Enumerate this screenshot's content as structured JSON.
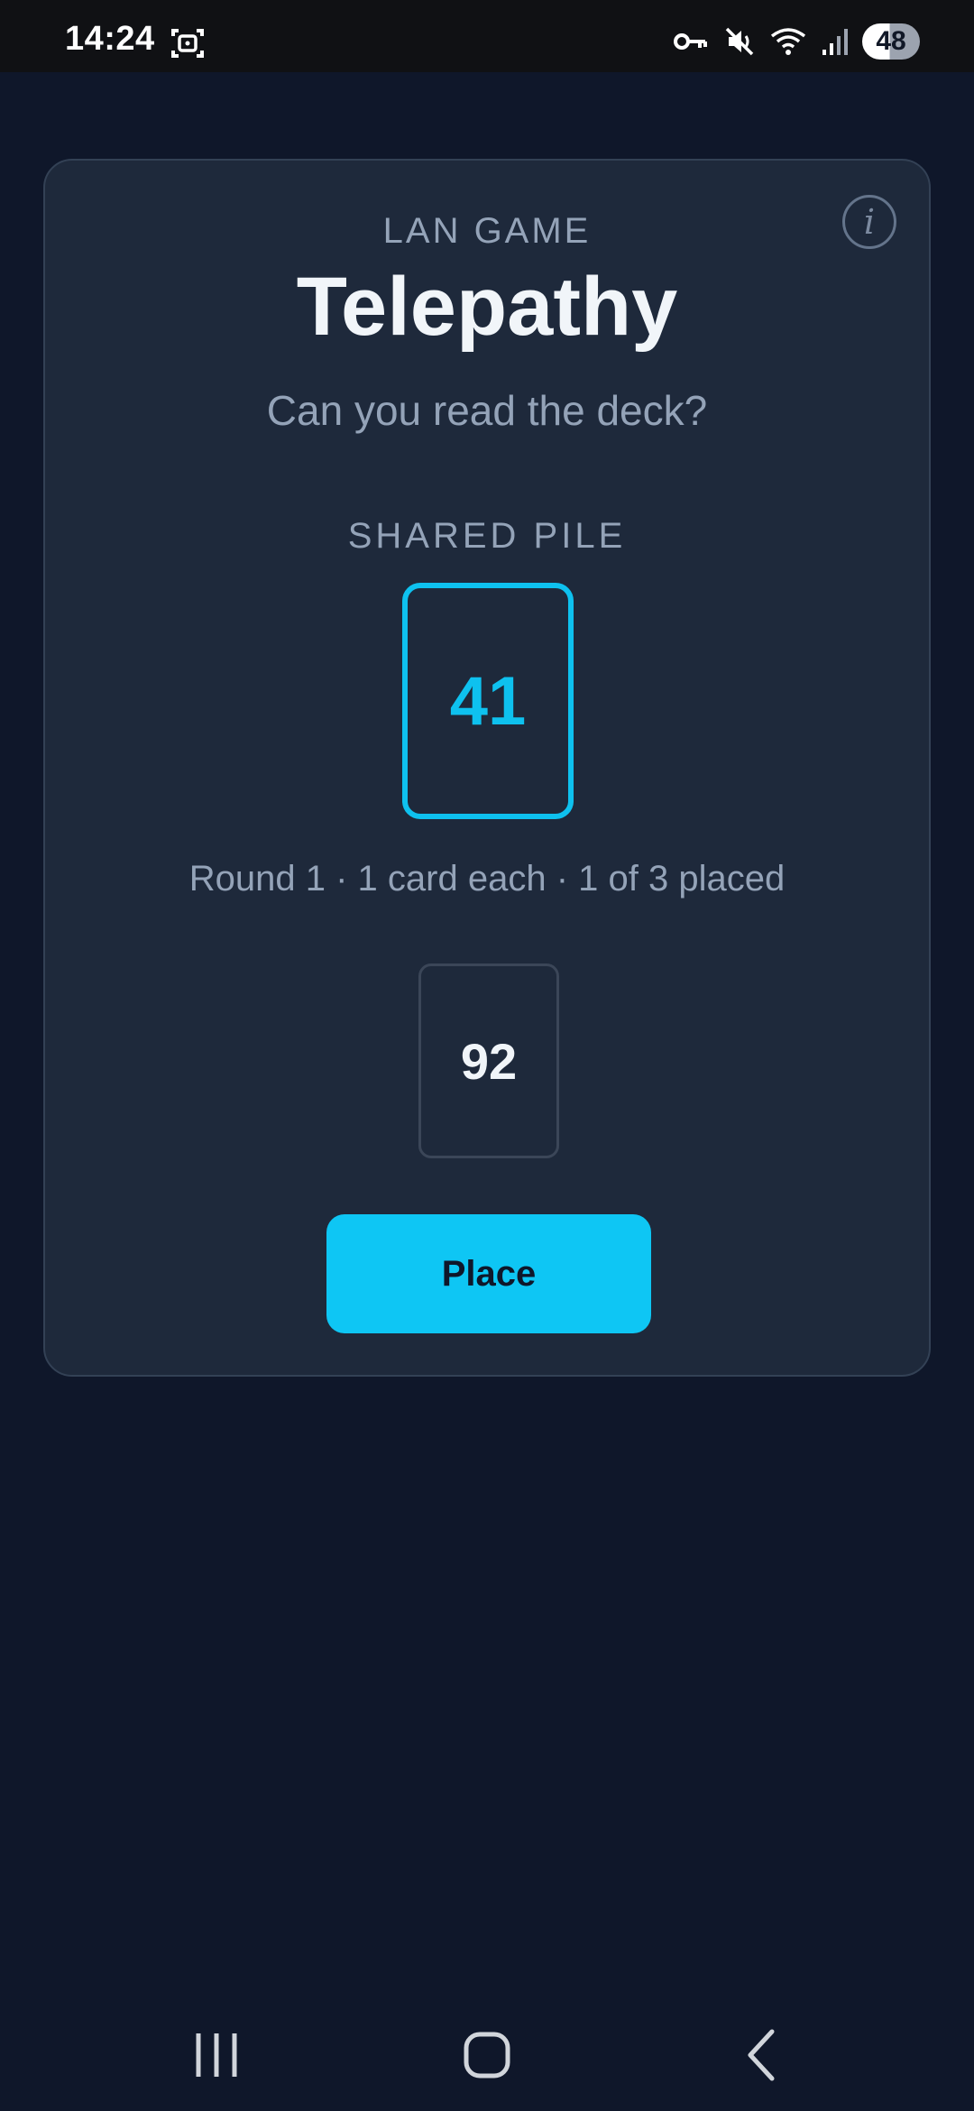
{
  "status_bar": {
    "time": "14:24",
    "battery": "48"
  },
  "game": {
    "eyebrow": "LAN GAME",
    "title": "Telepathy",
    "subtitle": "Can you read the deck?",
    "info_icon_glyph": "i",
    "shared_pile_label": "SHARED PILE",
    "shared_pile_value": "41",
    "round_status": "Round 1 · 1 card each · 1 of 3 placed",
    "hand_card_value": "92",
    "place_button_label": "Place"
  },
  "colors": {
    "background": "#0f172a",
    "card": "#1e293b",
    "accent": "#0ec1ef",
    "muted_text": "#94a3b8"
  },
  "icons": {
    "status_left": "screenshot-icon",
    "status_right": [
      "vpn-key-icon",
      "mute-icon",
      "wifi-icon",
      "signal-icon",
      "battery-icon"
    ],
    "nav": [
      "recent-apps-icon",
      "home-icon",
      "back-icon"
    ]
  }
}
